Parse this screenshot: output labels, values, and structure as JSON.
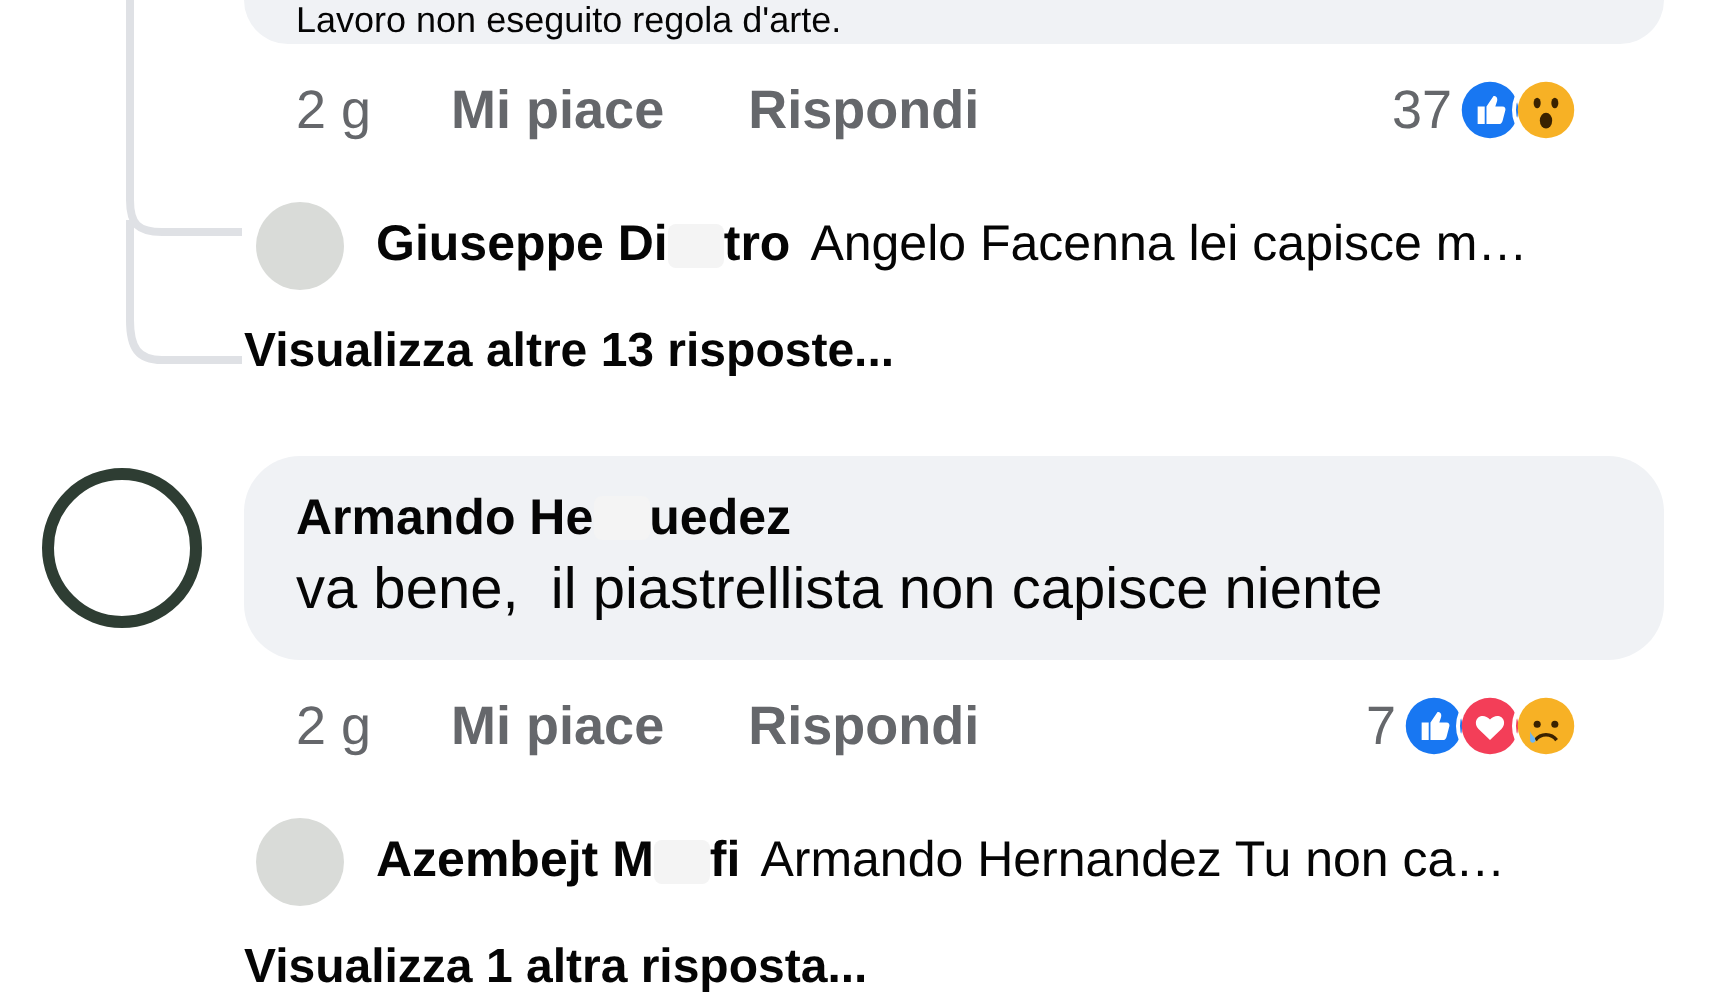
{
  "comments": [
    {
      "body": "Lavoro non eseguito regola d'arte.",
      "cut_top": true,
      "time": "2 g",
      "like": "Mi piace",
      "reply": "Rispondi",
      "count": "37",
      "reactions": [
        {
          "kind": "like"
        },
        {
          "kind": "wow"
        }
      ],
      "replies": [
        {
          "name_parts": [
            "Giuseppe Di",
            "tro"
          ],
          "text": "Angelo Facenna lei capisce m…"
        }
      ],
      "more": "Visualizza altre 13 risposte..."
    },
    {
      "name_parts": [
        "Armando He",
        "uedez"
      ],
      "body": "va bene,  il piastrellista non capisce niente",
      "cut_top": false,
      "time": "2 g",
      "like": "Mi piace",
      "reply": "Rispondi",
      "count": "7",
      "reactions": [
        {
          "kind": "like"
        },
        {
          "kind": "love"
        },
        {
          "kind": "sad"
        }
      ],
      "replies": [
        {
          "name_parts": [
            "Azembejt M",
            "fi"
          ],
          "text": "Armando Hernandez Tu non ca…"
        }
      ],
      "more": "Visualizza 1 altra risposta..."
    }
  ]
}
